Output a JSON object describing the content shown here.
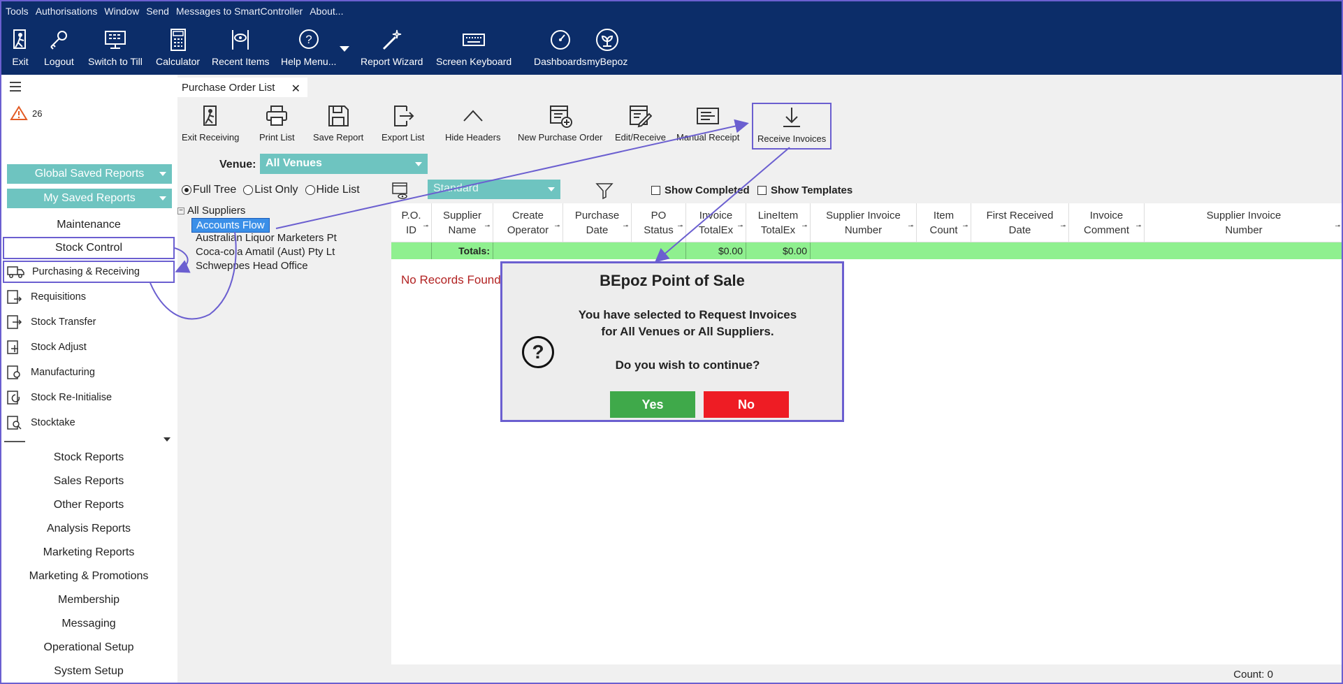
{
  "menu": [
    "Tools",
    "Authorisations",
    "Window",
    "Send",
    "Messages to SmartController",
    "About..."
  ],
  "toolbar": [
    {
      "label": "Exit",
      "icon": "exit-icon"
    },
    {
      "label": "Logout",
      "icon": "key-icon"
    },
    {
      "label": "Switch to Till",
      "icon": "till-icon"
    },
    {
      "label": "Calculator",
      "icon": "calculator-icon"
    },
    {
      "label": "Recent Items",
      "icon": "recent-icon"
    },
    {
      "label": "Help Menu...",
      "icon": "help-icon"
    },
    {
      "label": "Report Wizard",
      "icon": "wizard-icon"
    },
    {
      "label": "Screen Keyboard",
      "icon": "keyboard-icon"
    },
    {
      "label": "Dashboards",
      "icon": "dashboard-icon"
    },
    {
      "label": "myBepoz",
      "icon": "mybepoz-icon"
    }
  ],
  "sidebar": {
    "alert_count": "26",
    "global_reports": "Global Saved Reports",
    "my_reports": "My Saved Reports",
    "maintenance": "Maintenance",
    "stock_control": "Stock Control",
    "sub_items": [
      "Purchasing & Receiving",
      "Requisitions",
      "Stock Transfer",
      "Stock Adjust",
      "Manufacturing",
      "Stock Re-Initialise",
      "Stocktake"
    ],
    "sections": [
      "Stock Reports",
      "Sales Reports",
      "Other Reports",
      "Analysis Reports",
      "Marketing Reports",
      "Marketing & Promotions",
      "Membership",
      "Messaging",
      "Operational Setup",
      "System Setup"
    ]
  },
  "tab": {
    "label": "Purchase Order List"
  },
  "actions": [
    {
      "label": "Exit Receiving",
      "icon": "exit-receiving-icon"
    },
    {
      "label": "Print List",
      "icon": "printer-icon"
    },
    {
      "label": "Save Report",
      "icon": "save-icon"
    },
    {
      "label": "Export List",
      "icon": "export-icon"
    },
    {
      "label": "Hide Headers",
      "icon": "chevron-up-icon"
    },
    {
      "label": "New Purchase Order",
      "icon": "new-order-icon"
    },
    {
      "label": "Edit/Receive",
      "icon": "edit-icon"
    },
    {
      "label": "Manual Receipt",
      "icon": "receipt-icon"
    },
    {
      "label": "Receive Invoices",
      "icon": "download-icon"
    }
  ],
  "filters": {
    "venue_label": "Venue:",
    "venue_value": "All Venues",
    "view_modes": [
      "Full Tree",
      "List Only",
      "Hide List"
    ],
    "selected_view": "Full Tree",
    "layout_value": "Standard",
    "show_completed": "Show Completed",
    "show_templates": "Show Templates"
  },
  "tree": {
    "root": "All Suppliers",
    "children": [
      "Accounts Flow",
      "Australian Liquor Marketers Pt",
      "Coca-cola Amatil (Aust) Pty Lt",
      "Schweppes Head Office"
    ],
    "selected": "Accounts Flow"
  },
  "grid": {
    "columns": [
      "P.O. ID",
      "Supplier Name",
      "Create Operator",
      "Purchase Date",
      "PO Status",
      "Invoice TotalEx",
      "LineItem TotalEx",
      "Supplier Invoice Number",
      "Item Count",
      "First Received Date",
      "Invoice Comment",
      "Supplier Invoice Number"
    ],
    "totals_label": "Totals:",
    "invoice_total": "$0.00",
    "lineitem_total": "$0.00",
    "empty_message": "No Records Found",
    "count": "Count: 0"
  },
  "dialog": {
    "title": "BEpoz Point of Sale",
    "line1": "You have selected to Request Invoices",
    "line2": "for All Venues or All Suppliers.",
    "question": "Do you wish to continue?",
    "yes": "Yes",
    "no": "No"
  },
  "colors": {
    "navy": "#0c2d69",
    "teal": "#6ec4c0",
    "highlight": "#6b5fd0",
    "yes": "#3fa94a",
    "no": "#ee1c24",
    "totals": "#8ff08f"
  }
}
